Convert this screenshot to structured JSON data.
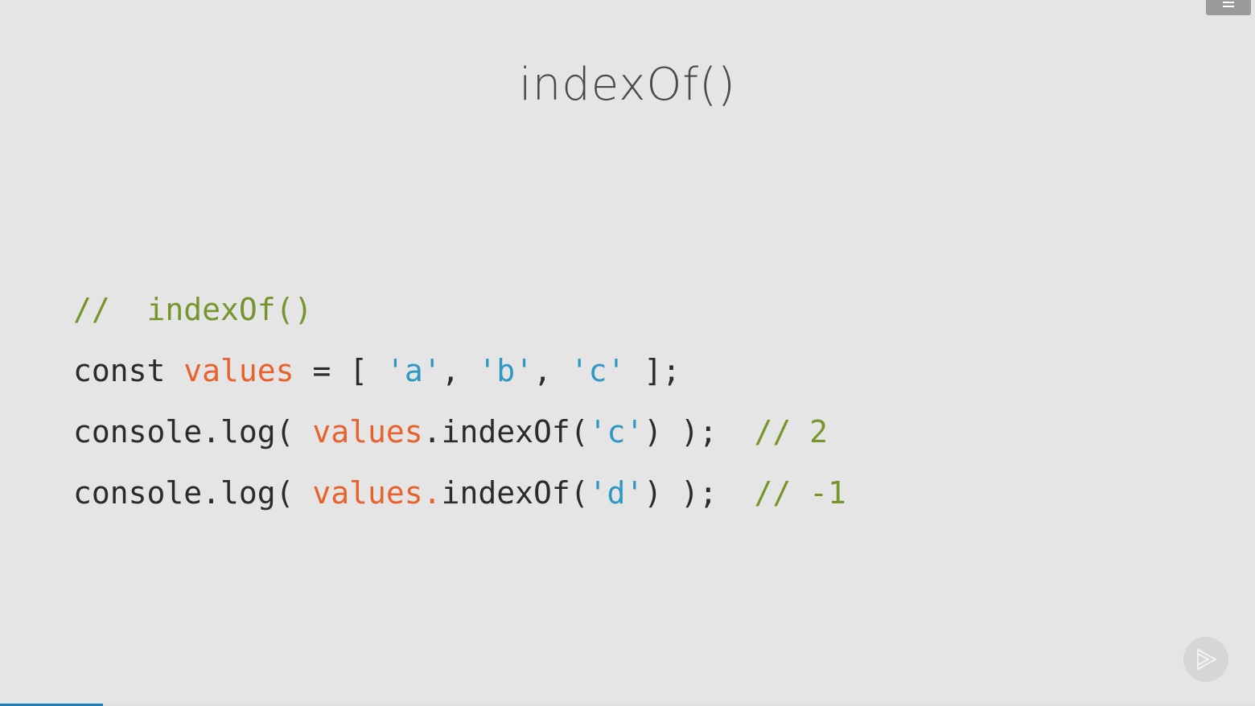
{
  "slide": {
    "title": "indexOf()"
  },
  "menu": {
    "icon": "hamburger-menu-icon"
  },
  "code": {
    "lines": [
      [
        {
          "text": "//  indexOf()",
          "kind": "comment"
        }
      ],
      [
        {
          "text": "const ",
          "kind": "plain"
        },
        {
          "text": "values",
          "kind": "var"
        },
        {
          "text": " = [ ",
          "kind": "plain"
        },
        {
          "text": "'a'",
          "kind": "str"
        },
        {
          "text": ", ",
          "kind": "plain"
        },
        {
          "text": "'b'",
          "kind": "str"
        },
        {
          "text": ", ",
          "kind": "plain"
        },
        {
          "text": "'c'",
          "kind": "str"
        },
        {
          "text": " ];",
          "kind": "plain"
        }
      ],
      [
        {
          "text": "console.log( ",
          "kind": "plain"
        },
        {
          "text": "values",
          "kind": "var"
        },
        {
          "text": ".indexOf(",
          "kind": "plain"
        },
        {
          "text": "'c'",
          "kind": "str"
        },
        {
          "text": ") );  ",
          "kind": "plain"
        },
        {
          "text": "// 2",
          "kind": "comment"
        }
      ],
      [
        {
          "text": "console.log( ",
          "kind": "plain"
        },
        {
          "text": "values.",
          "kind": "var"
        },
        {
          "text": "indexOf(",
          "kind": "plain"
        },
        {
          "text": "'d'",
          "kind": "str"
        },
        {
          "text": ") );  ",
          "kind": "plain"
        },
        {
          "text": "// -1",
          "kind": "comment"
        }
      ]
    ]
  },
  "player": {
    "play_icon": "play-logo-icon",
    "progress_fraction": 0.082
  },
  "colors": {
    "background": "#e5e5e5",
    "comment": "#77952d",
    "variable": "#e8622b",
    "string": "#2e97c4",
    "plain": "#2b2b2b",
    "progress": "#1c7fbf"
  }
}
